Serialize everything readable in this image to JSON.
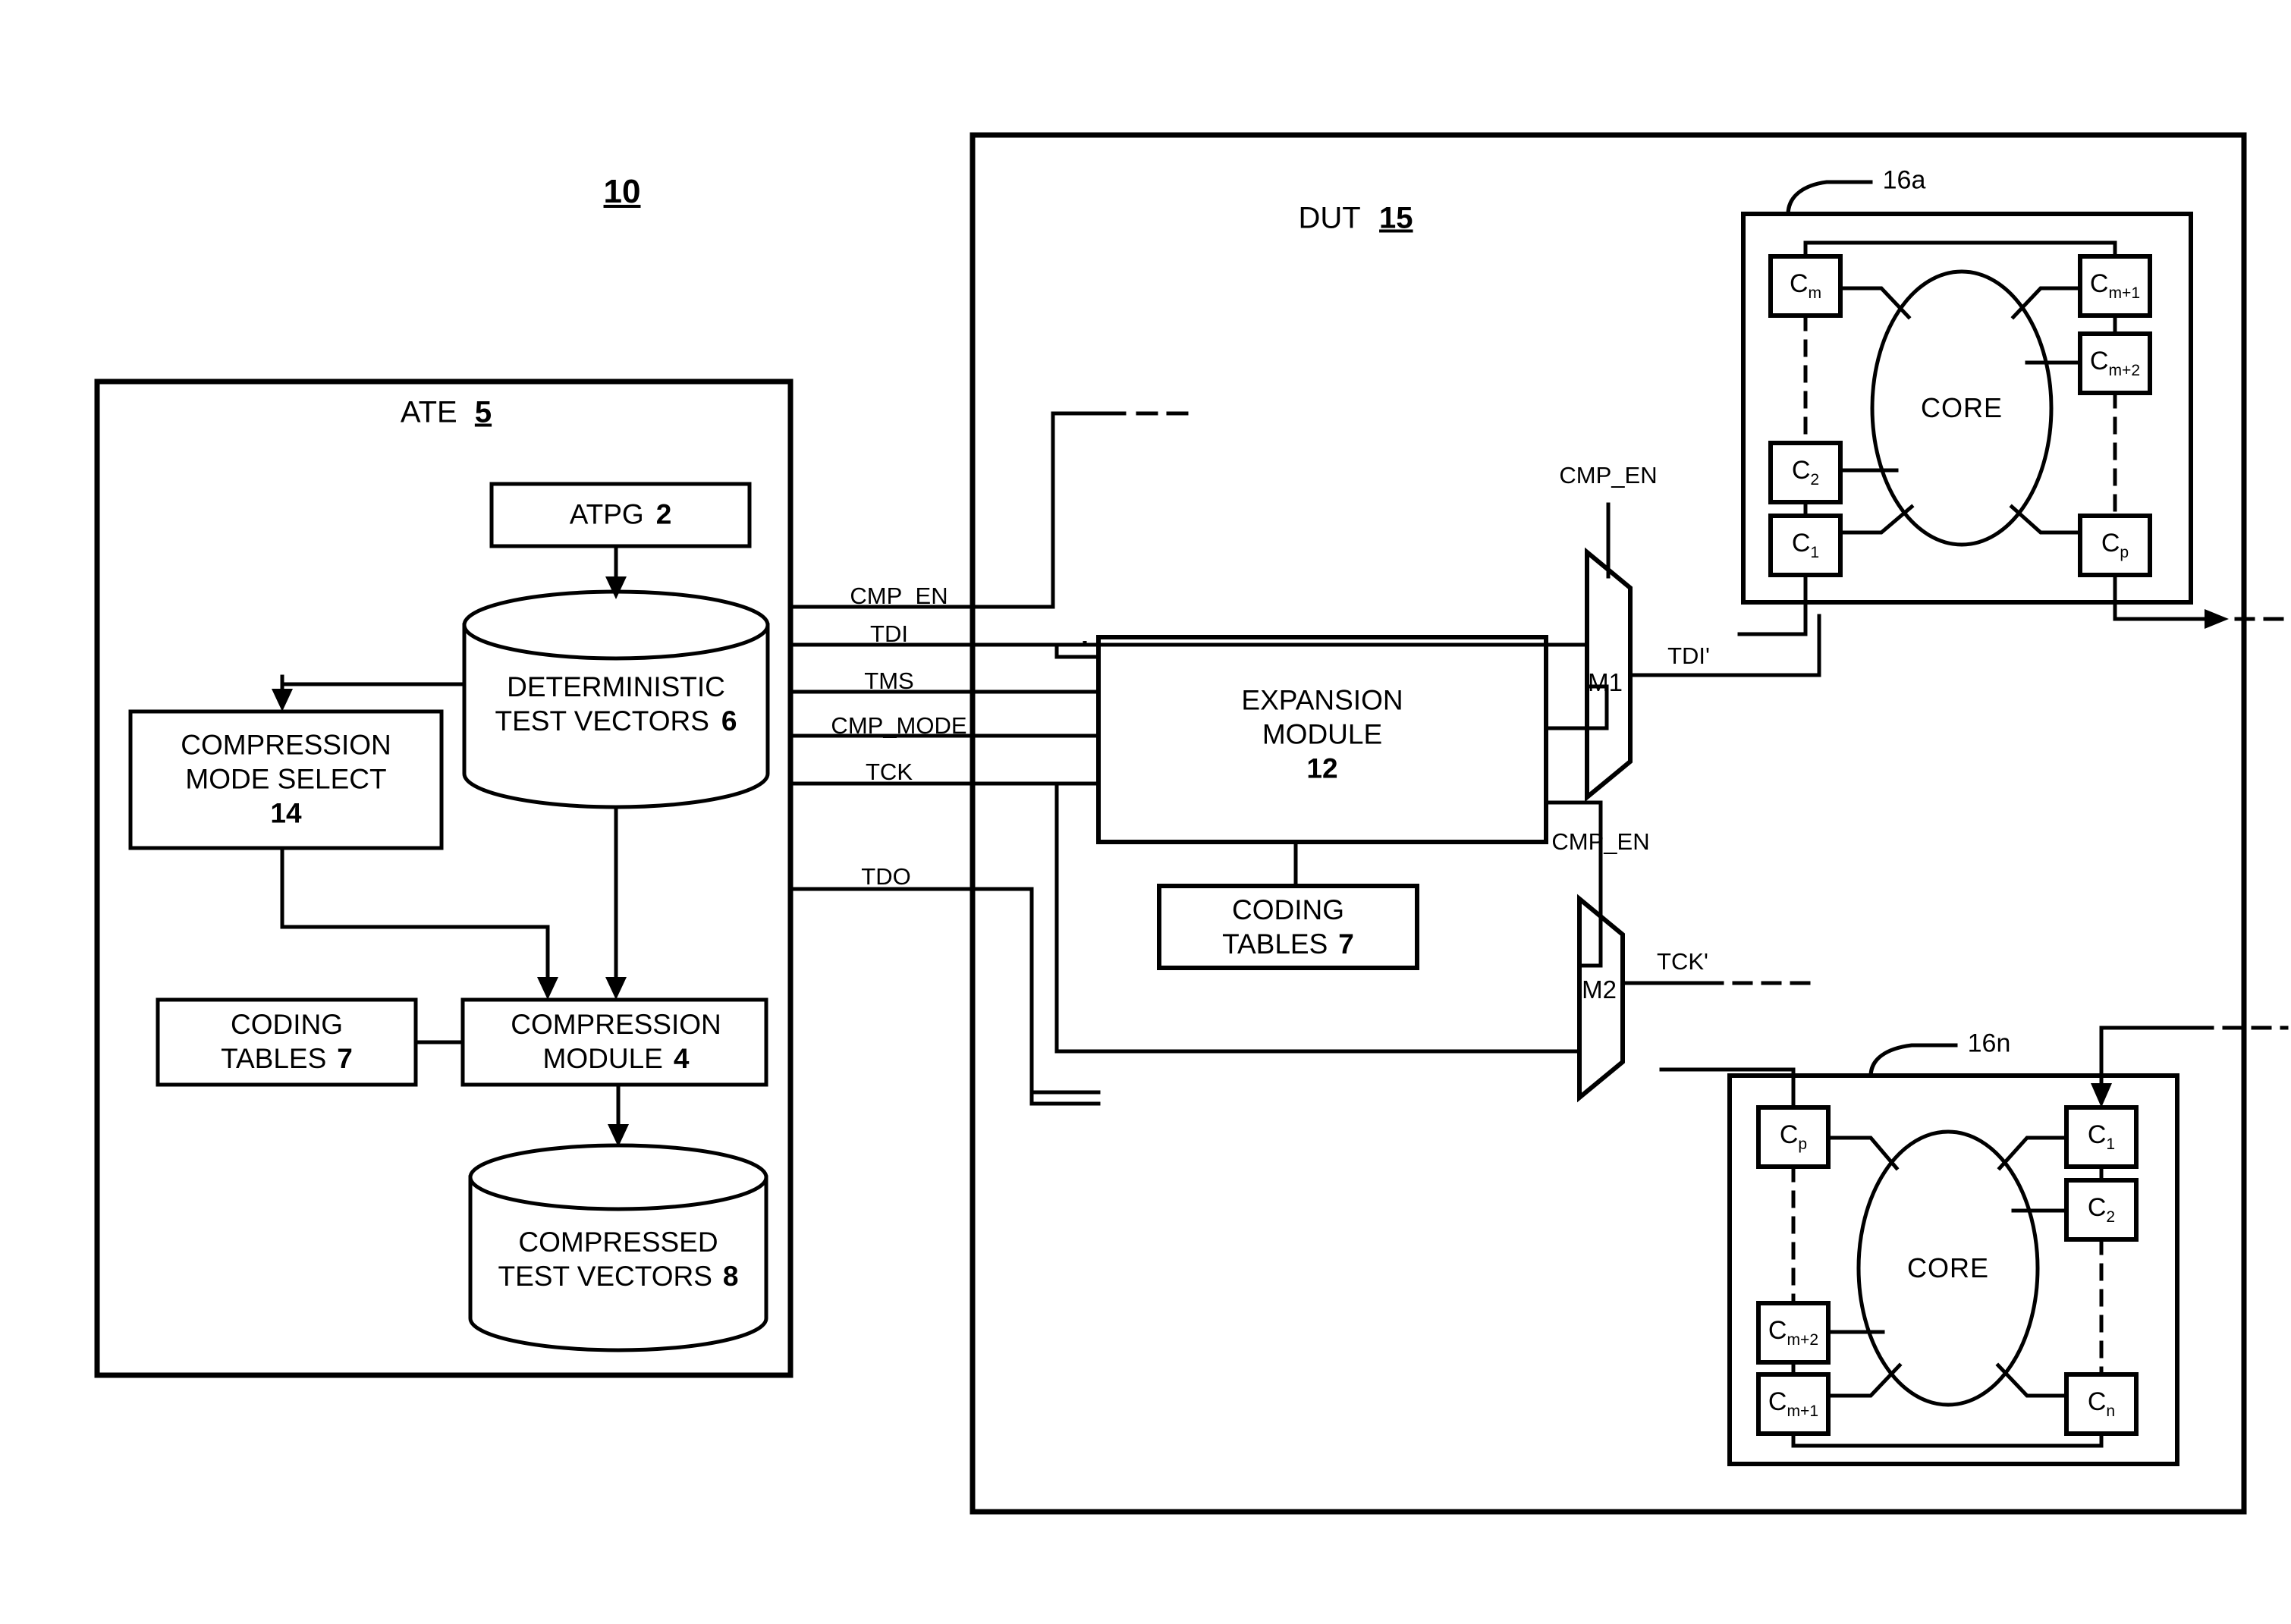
{
  "figure": {
    "number": "10",
    "ate": {
      "title": "ATE",
      "ref": "5"
    },
    "dut": {
      "title": "DUT",
      "ref": "15"
    }
  },
  "ate_blocks": {
    "atpg": {
      "line1": "ATPG",
      "ref": "2"
    },
    "deterministic_test_vectors": {
      "line1": "DETERMINISTIC",
      "line2": "TEST VECTORS",
      "ref": "6"
    },
    "compression_mode_select": {
      "line1": "COMPRESSION",
      "line2": "MODE SELECT",
      "ref": "14"
    },
    "coding_tables": {
      "line1": "CODING",
      "line2": "TABLES",
      "ref": "7"
    },
    "compression_module": {
      "line1": "COMPRESSION",
      "line2": "MODULE",
      "ref": "4"
    },
    "compressed_test_vectors": {
      "line1": "COMPRESSED",
      "line2": "TEST VECTORS",
      "ref": "8"
    }
  },
  "dut_blocks": {
    "expansion_module": {
      "line1": "EXPANSION",
      "line2": "MODULE",
      "ref": "12"
    },
    "coding_tables": {
      "line1": "CODING",
      "line2": "TABLES",
      "ref": "7"
    }
  },
  "signals": {
    "cmp_en": "CMP_EN",
    "tdi": "TDI",
    "tms": "TMS",
    "cmp_mode": "CMP_MODE",
    "tck": "TCK",
    "tdo": "TDO",
    "tdi_prime": "TDI'",
    "tck_prime": "TCK'"
  },
  "muxes": {
    "m1": {
      "label": "M1",
      "select": "CMP_EN",
      "output": "TDI'"
    },
    "m2": {
      "label": "M2",
      "select": "CMP_EN",
      "output": "TCK'"
    }
  },
  "cores": [
    {
      "ref": "16a",
      "core_label": "CORE",
      "cells_left": [
        {
          "base": "C",
          "sub": "m"
        },
        {
          "base": "C",
          "sub": "2"
        },
        {
          "base": "C",
          "sub": "1"
        }
      ],
      "cells_right": [
        {
          "base": "C",
          "sub": "m+1"
        },
        {
          "base": "C",
          "sub": "m+2"
        },
        {
          "base": "C",
          "sub": "p"
        }
      ]
    },
    {
      "ref": "16n",
      "core_label": "CORE",
      "cells_left": [
        {
          "base": "C",
          "sub": "p"
        },
        {
          "base": "C",
          "sub": "m+2"
        },
        {
          "base": "C",
          "sub": "m+1"
        }
      ],
      "cells_right": [
        {
          "base": "C",
          "sub": "1"
        },
        {
          "base": "C",
          "sub": "2"
        },
        {
          "base": "C",
          "sub": "n"
        }
      ]
    }
  ],
  "colors": {
    "line": "#000000",
    "background": "#ffffff"
  }
}
